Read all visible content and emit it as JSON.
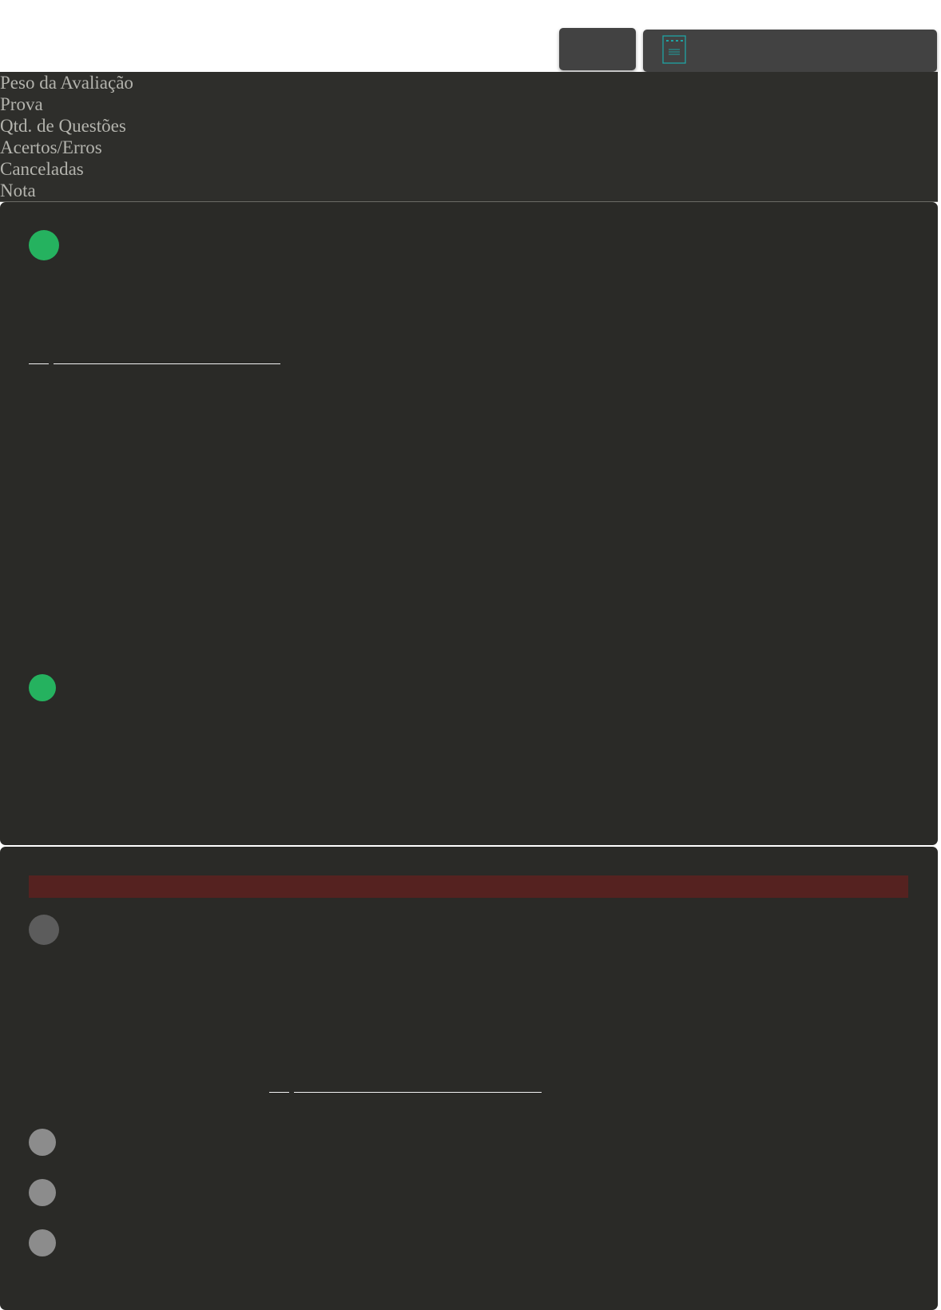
{
  "toolbar": {
    "small_button_label": "",
    "wide_button_label": "",
    "icon": "document-list-icon",
    "accent_color": "#1fa3a3"
  },
  "summary": {
    "rows": [
      {
        "label": "Peso da Avaliação"
      },
      {
        "label": "Prova"
      },
      {
        "label": "Qtd. de Questões"
      },
      {
        "label": "Acertos/Erros"
      },
      {
        "label": "Canceladas"
      },
      {
        "label": "Nota"
      }
    ]
  },
  "colors": {
    "correct": "#25b25f",
    "cancelled_banner": "#552220",
    "unanswered": "#8c8c8c",
    "card_background": "#2a2a27"
  }
}
